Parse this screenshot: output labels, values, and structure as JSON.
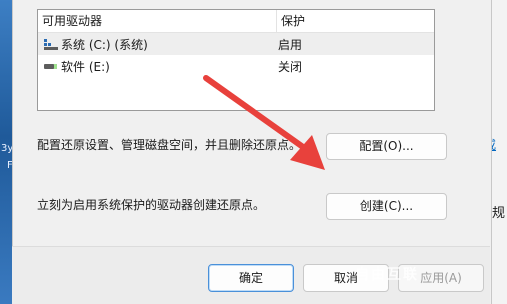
{
  "background": {
    "desktop_text_1": "3y",
    "desktop_text_2": "F",
    "right_window_link": "或",
    "right_window_text": "规"
  },
  "dialog": {
    "list": {
      "headers": {
        "drive": "可用驱动器",
        "protection": "保护"
      },
      "rows": [
        {
          "icon": "system-drive-icon",
          "drive": "系统 (C:) (系统)",
          "protection": "启用",
          "selected": true
        },
        {
          "icon": "drive-icon",
          "drive": "软件 (E:)",
          "protection": "关闭",
          "selected": false
        }
      ]
    },
    "configure_text": "配置还原设置、管理磁盘空间，并且删除还原点。",
    "configure_button": "配置(O)...",
    "create_text": "立刻为启用系统保护的驱动器创建还原点。",
    "create_button": "创建(C)...",
    "ok_button": "确定",
    "cancel_button": "取消",
    "apply_button": "应用(A)",
    "watermark": "自由互联"
  },
  "colors": {
    "accent": "#0067c0",
    "arrow": "#e8413c",
    "focus_border": "#4a90d9"
  }
}
